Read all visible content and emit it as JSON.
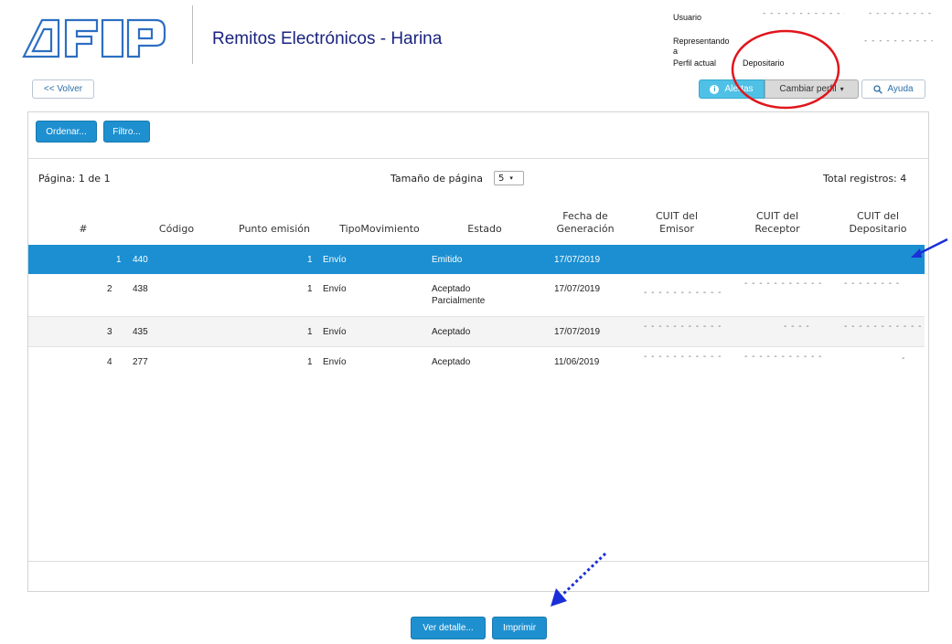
{
  "header": {
    "logo_text": "AFIP",
    "title": "Remitos Electrónicos - Harina",
    "user": {
      "usuario_label": "Usuario",
      "usuario_value": "- - - - - - - - - - - - -",
      "representando_label": "Representando",
      "representando_label_b": "a",
      "representando_value": "- - - - - - - - - - -",
      "perfil_label": "Perfil actual",
      "perfil_value": "Depositario"
    }
  },
  "toolbar": {
    "back_label": "<< Volver",
    "alertas_label": "Alertas",
    "cambiar_perfil_label": "Cambiar perfil",
    "ayuda_label": "Ayuda"
  },
  "panel": {
    "ordenar_label": "Ordenar...",
    "filtro_label": "Filtro...",
    "pagina_label": "Página: 1 de 1",
    "tamano_label": "Tamaño de página",
    "tamano_value": "5",
    "total_label": "Total registros: 4"
  },
  "table": {
    "columns": [
      {
        "label1": "#",
        "label2": ""
      },
      {
        "label1": "Código",
        "label2": ""
      },
      {
        "label1": "Punto emisión",
        "label2": ""
      },
      {
        "label1": "TipoMovimiento",
        "label2": ""
      },
      {
        "label1": "Estado",
        "label2": ""
      },
      {
        "label1": "Fecha de",
        "label2": "Generación"
      },
      {
        "label1": "CUIT del",
        "label2": "Emisor"
      },
      {
        "label1": "CUIT del",
        "label2": "Receptor"
      },
      {
        "label1": "CUIT del",
        "label2": "Depositario"
      }
    ],
    "rows": [
      {
        "num": "1",
        "codigo": "440",
        "punto": "1",
        "tipo": "Envío",
        "estado1": "Emitido",
        "estado2": "",
        "fecha": "17/07/2019",
        "emisor": "",
        "receptor": "",
        "depositario": ""
      },
      {
        "num": "2",
        "codigo": "438",
        "punto": "1",
        "tipo": "Envío",
        "estado1": "Aceptado",
        "estado2": "Parcialmente",
        "fecha": "17/07/2019",
        "emisor": "- - - - - - - - - - -",
        "receptor": "- - - - - - - - - - -",
        "depositario": "- - - - - - - -"
      },
      {
        "num": "3",
        "codigo": "435",
        "punto": "1",
        "tipo": "Envío",
        "estado1": "Aceptado",
        "estado2": "",
        "fecha": "17/07/2019",
        "emisor": "- - - - - - - - - - -",
        "receptor": "- - - -",
        "depositario": "- - - - - - - - - - -"
      },
      {
        "num": "4",
        "codigo": "277",
        "punto": "1",
        "tipo": "Envío",
        "estado1": "Aceptado",
        "estado2": "",
        "fecha": "11/06/2019",
        "emisor": "- - - - - - - - - - -",
        "receptor": "- - - - - - - - - - -",
        "depositario": "-"
      }
    ]
  },
  "footer": {
    "ver_detalle_label": "Ver detalle...",
    "imprimir_label": "Imprimir"
  },
  "colors": {
    "primary": "#1e90d0",
    "selected_row": "#1b8fd2",
    "title": "#1a237e",
    "annotation_red": "#e0161c",
    "annotation_blue": "#1a2fd8"
  }
}
